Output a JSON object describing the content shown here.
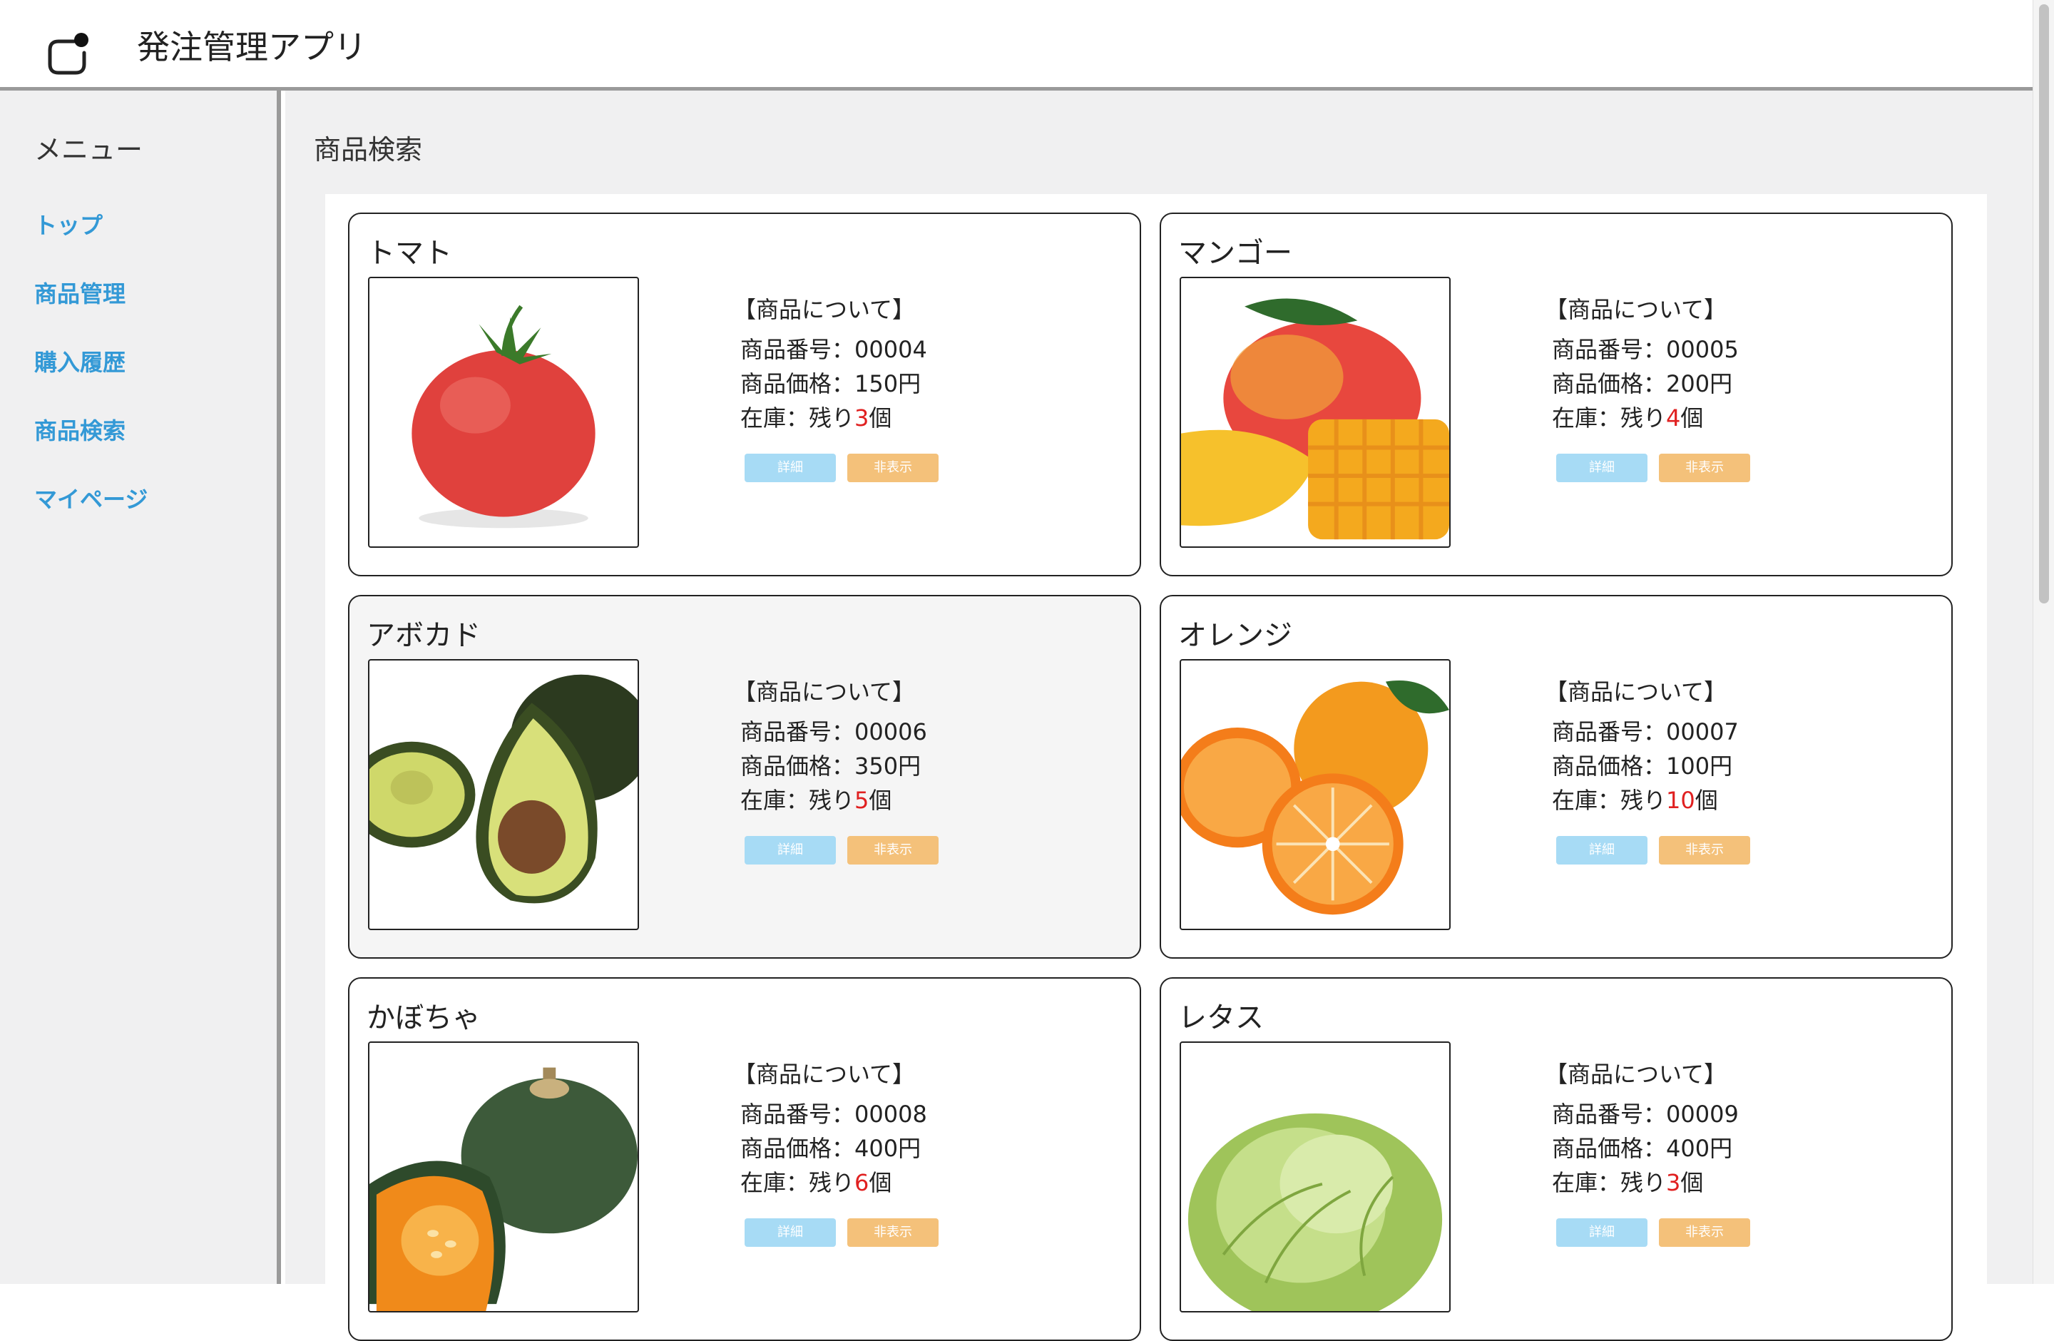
{
  "app": {
    "title": "発注管理アプリ"
  },
  "sidebar": {
    "title": "メニュー",
    "items": [
      {
        "label": "トップ"
      },
      {
        "label": "商品管理"
      },
      {
        "label": "購入履歴"
      },
      {
        "label": "商品検索"
      },
      {
        "label": "マイページ"
      }
    ]
  },
  "page": {
    "title": "商品検索"
  },
  "labels": {
    "about": "【商品について】",
    "number_prefix": "商品番号：",
    "price_prefix": "商品価格：",
    "price_suffix": "円",
    "stock_prefix": "在庫：残り",
    "stock_suffix": "個",
    "detail_button": "詳細",
    "hide_button": "非表示"
  },
  "products": [
    {
      "name": "トマト",
      "number": "00004",
      "price": "150",
      "stock": "3",
      "image": "tomato-image"
    },
    {
      "name": "マンゴー",
      "number": "00005",
      "price": "200",
      "stock": "4",
      "image": "mango-image"
    },
    {
      "name": "アボカド",
      "number": "00006",
      "price": "350",
      "stock": "5",
      "image": "avocado-image"
    },
    {
      "name": "オレンジ",
      "number": "00007",
      "price": "100",
      "stock": "10",
      "image": "orange-image"
    },
    {
      "name": "かぼちゃ",
      "number": "00008",
      "price": "400",
      "stock": "6",
      "image": "pumpkin-image"
    },
    {
      "name": "レタス",
      "number": "00009",
      "price": "400",
      "stock": "3",
      "image": "lettuce-image"
    }
  ],
  "colors": {
    "link": "#3399d6",
    "stock_highlight": "#e02020",
    "detail_button": "#a7dbf5",
    "hide_button": "#f4c17a"
  }
}
